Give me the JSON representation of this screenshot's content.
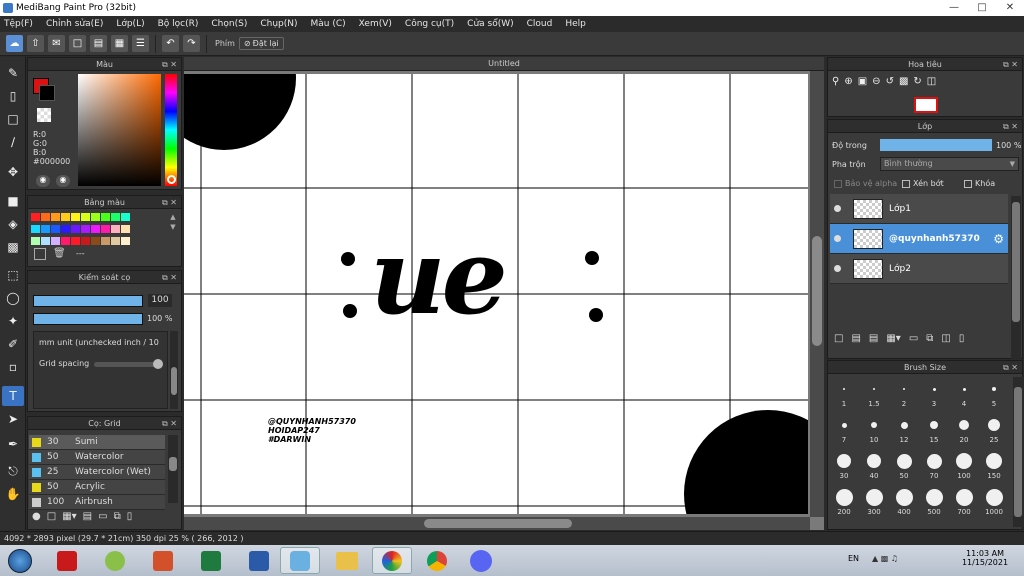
{
  "window": {
    "title": "MediBang Paint Pro (32bit)"
  },
  "menu": [
    "Tệp(F)",
    "Chỉnh sửa(E)",
    "Lớp(L)",
    "Bộ lọc(R)",
    "Chọn(S)",
    "Chụp(N)",
    "Màu (C)",
    "Xem(V)",
    "Công cụ(T)",
    "Cửa sổ(W)",
    "Cloud",
    "Help"
  ],
  "toolbar": {
    "keys_label": "Phím",
    "reset_label": "Đặt lại"
  },
  "color_panel": {
    "title": "Màu",
    "r": "R:0",
    "g": "G:0",
    "b": "B:0",
    "hex": "#000000",
    "primary": "#e01010",
    "secondary": "#000000"
  },
  "palette_panel": {
    "title": "Bảng màu",
    "dashes": "---",
    "colors": [
      "#ff2020",
      "#ff6a1a",
      "#ff9a1a",
      "#ffcc1a",
      "#fff21a",
      "#d8ff1a",
      "#9aff1a",
      "#4aff1a",
      "#1aff6a",
      "#1affd0",
      "#1ad8ff",
      "#1a9aff",
      "#1a5aff",
      "#2a1aff",
      "#6a1aff",
      "#aa1aff",
      "#ee1aff",
      "#ff1aaa",
      "#ffb0c0",
      "#ffe0b0",
      "#b0ffb0",
      "#b0e0ff",
      "#d0b0ff",
      "#ff1a6a",
      "#ff1a2a",
      "#c81a1a",
      "#8a4a1a",
      "#c89a6a",
      "#e0c8a0",
      "#fff0d0"
    ]
  },
  "brush_control": {
    "title": "Kiểm soát cọ",
    "size_value": 100,
    "size_text": "100",
    "opacity_value": 100,
    "opacity_text": "100 %",
    "unit_text": "mm unit (unchecked inch / 10",
    "grid_spacing_label": "Grid spacing"
  },
  "brush_list": {
    "title": "Cọ: Grid",
    "items": [
      {
        "size": "30",
        "name": "Sumi",
        "color": "#e8d81a",
        "selected": true
      },
      {
        "size": "50",
        "name": "Watercolor",
        "color": "#5ac0f0",
        "selected": false
      },
      {
        "size": "25",
        "name": "Watercolor (Wet)",
        "color": "#5ac0f0",
        "selected": false
      },
      {
        "size": "50",
        "name": "Acrylic",
        "color": "#e8d81a",
        "selected": false
      },
      {
        "size": "100",
        "name": "Airbrush",
        "color": "#cccccc",
        "selected": false
      }
    ]
  },
  "canvas": {
    "doc_title": "Untitled",
    "main_text": "ue",
    "watermark_lines": [
      "@QUYNHANH57370",
      "HOIDAP247",
      "#DARWIN"
    ]
  },
  "navigator": {
    "title": "Hoa tiêu"
  },
  "layer_panel": {
    "title": "Lớp",
    "opacity_label": "Độ trong",
    "opacity_text": "100 %",
    "opacity_value": 100,
    "blend_label": "Pha trộn",
    "blend_value": "Bình thường",
    "protect_alpha": "Bảo vệ alpha",
    "clipping": "Xén bớt",
    "lock": "Khóa",
    "layers": [
      {
        "name": "Lớp1",
        "selected": false
      },
      {
        "name": "@quynhanh57370",
        "selected": true
      },
      {
        "name": "Lớp2",
        "selected": false
      }
    ]
  },
  "brush_size": {
    "title": "Brush Size",
    "sizes": [
      "1",
      "1.5",
      "2",
      "3",
      "4",
      "5",
      "7",
      "10",
      "12",
      "15",
      "20",
      "25",
      "30",
      "40",
      "50",
      "70",
      "100",
      "150",
      "200",
      "300",
      "400",
      "500",
      "700",
      "1000"
    ]
  },
  "status": {
    "text": "4092 * 2893 pixel   (29.7 * 21cm)   350 dpi   25 %   ( 266, 2012 )"
  },
  "taskbar": {
    "lang": "EN",
    "time": "11:03 AM",
    "date": "11/15/2021"
  }
}
